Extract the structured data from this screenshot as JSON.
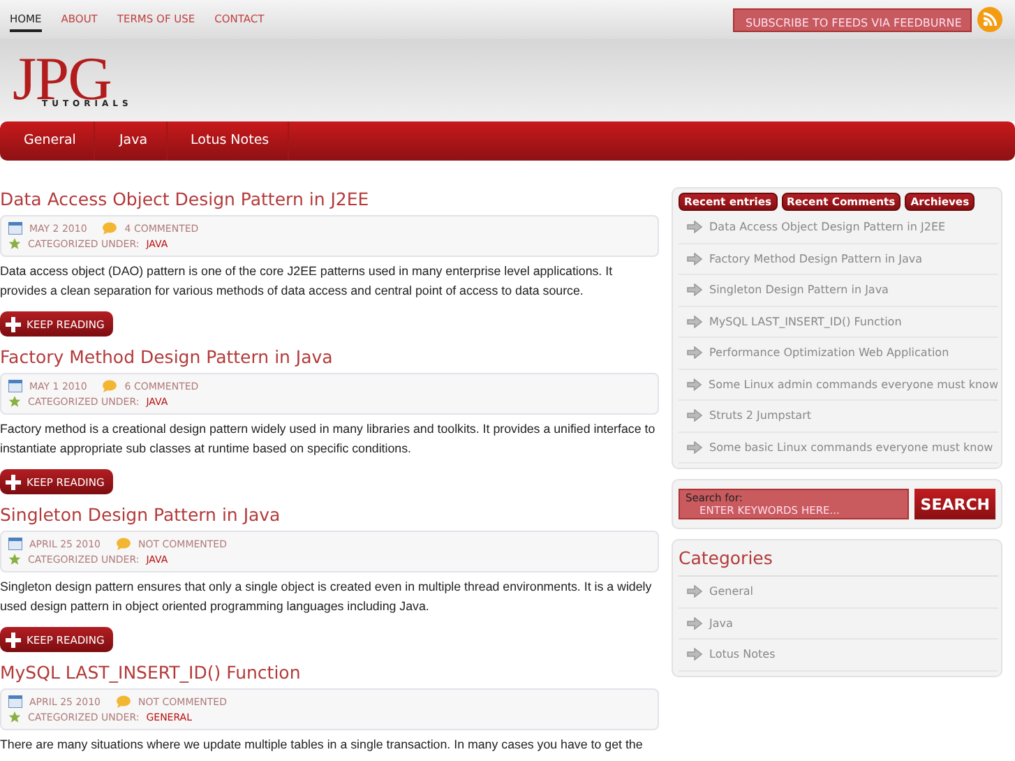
{
  "top_nav": [
    {
      "label": "HOME",
      "selected": true
    },
    {
      "label": "ABOUT",
      "selected": false
    },
    {
      "label": "TERMS OF USE",
      "selected": false
    },
    {
      "label": "CONTACT",
      "selected": false
    }
  ],
  "subscribe": "SUBSCRIBE TO FEEDS VIA FEEDBURNE",
  "logo": {
    "main": "JPG",
    "sub": "TUTORIALS"
  },
  "main_nav": [
    "General",
    "Java",
    "Lotus Notes"
  ],
  "posts": [
    {
      "title": "Data Access Object Design Pattern in J2EE",
      "date": "MAY 2 2010",
      "comments": "4 COMMENTED",
      "category_label": "CATEGORIZED UNDER:",
      "category": "JAVA",
      "excerpt": "Data access object (DAO) pattern is one of the core J2EE patterns used in many enterprise level applications. It provides a clean separation for various methods of data access and central point of access to data source.",
      "button": "KEEP READING"
    },
    {
      "title": "Factory Method Design Pattern in Java",
      "date": "MAY 1 2010",
      "comments": "6 COMMENTED",
      "category_label": "CATEGORIZED UNDER:",
      "category": "JAVA",
      "excerpt": "Factory method is a creational design pattern widely used in many libraries and toolkits. It provides a unified interface to instantiate appropriate sub classes at runtime based on specific conditions.",
      "button": "KEEP READING"
    },
    {
      "title": "Singleton Design Pattern in Java",
      "date": "APRIL 25 2010",
      "comments": "NOT COMMENTED",
      "category_label": "CATEGORIZED UNDER:",
      "category": "JAVA",
      "excerpt": "Singleton design pattern ensures that only a single object is created even in multiple thread environments. It is a widely used design pattern in object oriented programming languages including Java.",
      "button": "KEEP READING"
    },
    {
      "title": "MySQL LAST_INSERT_ID() Function",
      "date": "APRIL 25 2010",
      "comments": "NOT COMMENTED",
      "category_label": "CATEGORIZED UNDER:",
      "category": "GENERAL",
      "excerpt": "There are many situations where we update multiple tables in a single transaction. In many cases you have to get the"
    }
  ],
  "sidebar": {
    "tabs": [
      "Recent entries",
      "Recent Comments",
      "Archieves"
    ],
    "recent": [
      "Data Access Object Design Pattern in J2EE",
      "Factory Method Design Pattern in Java",
      "Singleton Design Pattern in Java",
      "MySQL LAST_INSERT_ID() Function",
      "Performance Optimization Web Application",
      "Some Linux admin commands everyone must know",
      "Struts 2 Jumpstart",
      "Some basic Linux commands everyone must know"
    ],
    "search": {
      "label": "Search for:",
      "placeholder": "ENTER KEYWORDS HERE...",
      "button": "SEARCH"
    },
    "categories_title": "Categories",
    "categories": [
      "General",
      "Java",
      "Lotus Notes"
    ]
  }
}
